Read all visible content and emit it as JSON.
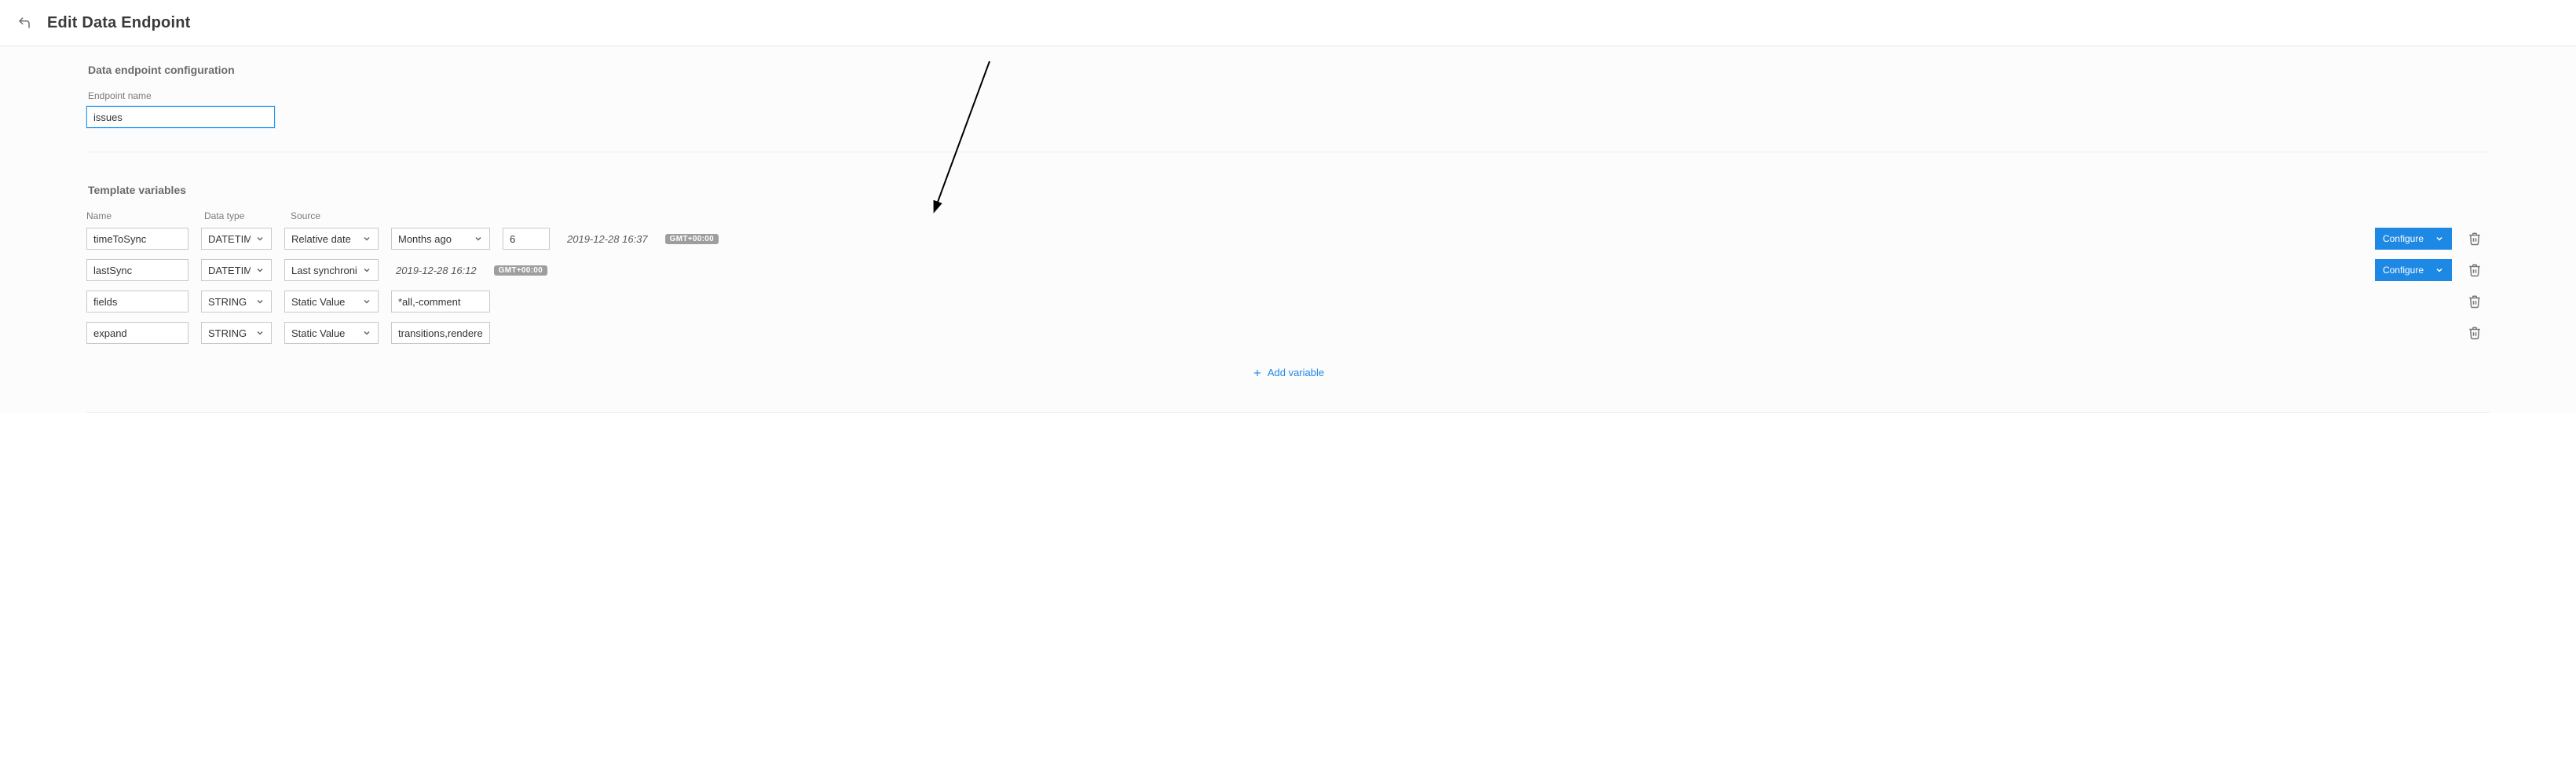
{
  "header": {
    "title": "Edit Data Endpoint"
  },
  "config": {
    "section_title": "Data endpoint configuration",
    "endpoint_name_label": "Endpoint name",
    "endpoint_name_value": "issues"
  },
  "tv": {
    "section_title": "Template variables",
    "headers": {
      "name": "Name",
      "dtype": "Data type",
      "source": "Source"
    },
    "rows": [
      {
        "name": "timeToSync",
        "dtype": "DATETIME",
        "source": "Relative date",
        "unit": "Months ago",
        "amount": "6",
        "datetime": "2019-12-28 16:37",
        "tz": "GMT+00:00",
        "configure": "Configure"
      },
      {
        "name": "lastSync",
        "dtype": "DATETIME",
        "source": "Last synchronizati",
        "datetime": "2019-12-28 16:12",
        "tz": "GMT+00:00",
        "configure": "Configure"
      },
      {
        "name": "fields",
        "dtype": "STRING",
        "source": "Static Value",
        "value": "*all,-comment"
      },
      {
        "name": "expand",
        "dtype": "STRING",
        "source": "Static Value",
        "value": "transitions,renderedFi"
      }
    ],
    "add_label": "Add variable"
  }
}
